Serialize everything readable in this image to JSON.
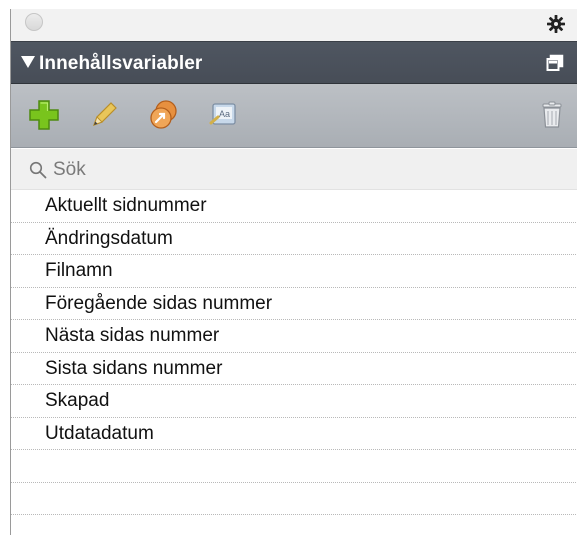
{
  "panel": {
    "title": "Innehållsvariabler"
  },
  "topbar": {
    "icons": [
      "window-dot",
      "gear-icon"
    ]
  },
  "header": {
    "icons": [
      "disclosure-triangle-icon",
      "popout-icon"
    ]
  },
  "toolbar": {
    "buttons": [
      "add-icon",
      "edit-pencil-icon",
      "convert-icon",
      "insert-variable-icon",
      "trash-icon"
    ]
  },
  "search": {
    "placeholder": "Sök"
  },
  "variables": [
    "Aktuellt sidnummer",
    "Ändringsdatum",
    "Filnamn",
    "Föregående sidas nummer",
    "Nästa sidas nummer",
    "Sista sidans nummer",
    "Skapad",
    "Utdatadatum"
  ],
  "colors": {
    "header_bg": "#4b525c",
    "toolbar_bg": "#b3b8be",
    "add_green": "#7cc31f",
    "pencil_yellow": "#e7c24e",
    "convert_orange": "#e28a3a"
  }
}
